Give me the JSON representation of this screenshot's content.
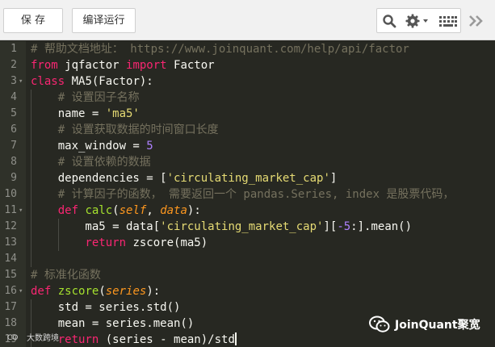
{
  "toolbar": {
    "save_label": "保 存",
    "run_label": "编译运行",
    "icons": [
      "search-icon",
      "gear-icon",
      "keyboard-icon",
      "expand-icon"
    ]
  },
  "editor": {
    "lines": [
      {
        "n": "1",
        "tokens": [
          {
            "c": "cm",
            "t": "# 帮助文档地址： https://www.joinquant.com/help/api/factor"
          }
        ]
      },
      {
        "n": "2",
        "tokens": [
          {
            "c": "kw",
            "t": "from"
          },
          {
            "c": "tx",
            "t": " jqfactor "
          },
          {
            "c": "kw",
            "t": "import"
          },
          {
            "c": "tx",
            "t": " Factor"
          }
        ]
      },
      {
        "n": "3",
        "fold": true,
        "tokens": [
          {
            "c": "kw",
            "t": "class"
          },
          {
            "c": "tx",
            "t": " MA5(Factor):"
          }
        ]
      },
      {
        "n": "4",
        "indent": 1,
        "tokens": [
          {
            "c": "cm",
            "t": "    # 设置因子名称"
          }
        ]
      },
      {
        "n": "5",
        "indent": 1,
        "tokens": [
          {
            "c": "tx",
            "t": "    name = "
          },
          {
            "c": "str",
            "t": "'ma5'"
          }
        ]
      },
      {
        "n": "6",
        "indent": 1,
        "tokens": [
          {
            "c": "cm",
            "t": "    # 设置获取数据的时间窗口长度"
          }
        ]
      },
      {
        "n": "7",
        "indent": 1,
        "tokens": [
          {
            "c": "tx",
            "t": "    max_window = "
          },
          {
            "c": "num",
            "t": "5"
          }
        ]
      },
      {
        "n": "8",
        "indent": 1,
        "tokens": [
          {
            "c": "cm",
            "t": "    # 设置依赖的数据"
          }
        ]
      },
      {
        "n": "9",
        "indent": 1,
        "tokens": [
          {
            "c": "tx",
            "t": "    dependencies = ["
          },
          {
            "c": "str",
            "t": "'circulating_market_cap'"
          },
          {
            "c": "tx",
            "t": "]"
          }
        ]
      },
      {
        "n": "10",
        "indent": 1,
        "tokens": [
          {
            "c": "cm",
            "t": "    # 计算因子的函数， 需要返回一个 pandas.Series, index 是股票代码，"
          }
        ]
      },
      {
        "n": "11",
        "fold": true,
        "indent": 1,
        "tokens": [
          {
            "c": "kw",
            "t": "    def"
          },
          {
            "c": "fn",
            "t": " calc"
          },
          {
            "c": "tx",
            "t": "("
          },
          {
            "c": "arg",
            "t": "self"
          },
          {
            "c": "tx",
            "t": ", "
          },
          {
            "c": "arg",
            "t": "data"
          },
          {
            "c": "tx",
            "t": "):"
          }
        ]
      },
      {
        "n": "12",
        "indent": 2,
        "tokens": [
          {
            "c": "tx",
            "t": "        ma5 = data["
          },
          {
            "c": "str",
            "t": "'circulating_market_cap'"
          },
          {
            "c": "tx",
            "t": "]["
          },
          {
            "c": "num",
            "t": "-5"
          },
          {
            "c": "tx",
            "t": ":].mean()"
          }
        ]
      },
      {
        "n": "13",
        "indent": 2,
        "tokens": [
          {
            "c": "kw",
            "t": "        return"
          },
          {
            "c": "tx",
            "t": " zscore(ma5)"
          }
        ]
      },
      {
        "n": "14",
        "indent": 1,
        "tokens": [
          {
            "c": "tx",
            "t": ""
          }
        ]
      },
      {
        "n": "15",
        "tokens": [
          {
            "c": "cm",
            "t": "# 标准化函数"
          }
        ]
      },
      {
        "n": "16",
        "fold": true,
        "tokens": [
          {
            "c": "kw",
            "t": "def"
          },
          {
            "c": "fn",
            "t": " zscore"
          },
          {
            "c": "tx",
            "t": "("
          },
          {
            "c": "arg",
            "t": "series"
          },
          {
            "c": "tx",
            "t": "):"
          }
        ]
      },
      {
        "n": "17",
        "indent": 1,
        "tokens": [
          {
            "c": "tx",
            "t": "    std = series.std()"
          }
        ]
      },
      {
        "n": "18",
        "indent": 1,
        "tokens": [
          {
            "c": "tx",
            "t": "    mean = series.mean()"
          }
        ]
      },
      {
        "n": "19",
        "indent": 1,
        "cursor": true,
        "tokens": [
          {
            "c": "kw",
            "t": "    return"
          },
          {
            "c": "tx",
            "t": " (series - mean)/std"
          }
        ]
      }
    ]
  },
  "watermark": {
    "left_text": "大数跨境",
    "right_text": "JoinQuant聚宽"
  },
  "colors": {
    "editor_bg": "#272822",
    "keyword": "#f92672",
    "string": "#e6db74",
    "number": "#ae81ff",
    "comment": "#75715e",
    "function": "#a6e22e",
    "argument": "#fd971f"
  }
}
